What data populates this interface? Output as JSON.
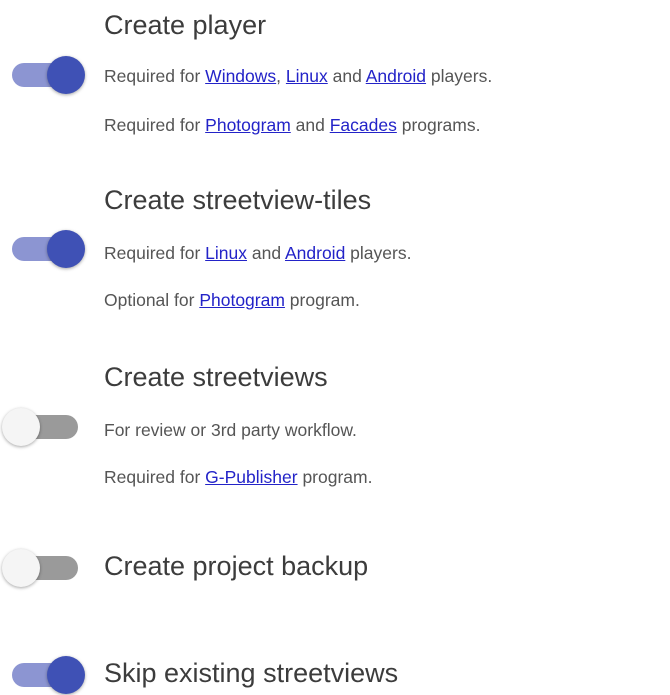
{
  "options": [
    {
      "title": "Create player",
      "enabled": true,
      "line1": {
        "p1": "Required for ",
        "link1": "Windows",
        "p2": ", ",
        "link2": "Linux",
        "p3": " and ",
        "link3": "Android",
        "p4": " players."
      },
      "line2": {
        "p1": "Required for ",
        "link1": "Photogram",
        "p2": " and ",
        "link2": "Facades",
        "p3": " programs."
      }
    },
    {
      "title": "Create streetview-tiles",
      "enabled": true,
      "line1": {
        "p1": "Required for ",
        "link1": "Linux",
        "p2": " and ",
        "link2": "Android",
        "p3": " players."
      },
      "line2": {
        "p1": "Optional for ",
        "link1": "Photogram",
        "p2": " program."
      }
    },
    {
      "title": "Create streetviews",
      "enabled": false,
      "line1": {
        "p1": "For review or 3rd party workflow."
      },
      "line2": {
        "p1": "Required for ",
        "link1": "G-Publisher",
        "p2": " program."
      }
    },
    {
      "title": "Create project backup",
      "enabled": false
    },
    {
      "title": "Skip existing streetviews",
      "enabled": true
    }
  ],
  "colors": {
    "toggle_on_knob": "#3f51b5",
    "toggle_on_track": "#8c95d2",
    "toggle_off_knob": "#f5f5f5",
    "toggle_off_track": "#9a9a9a",
    "link": "#2323c8"
  }
}
